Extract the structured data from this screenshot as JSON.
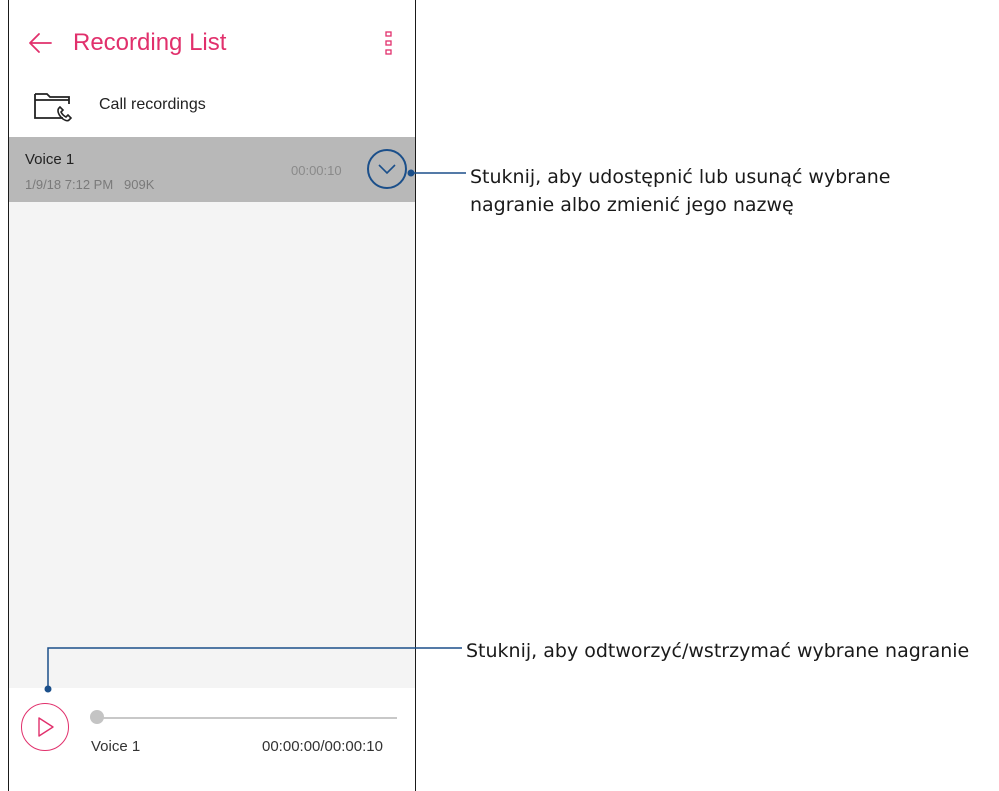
{
  "header": {
    "title": "Recording List",
    "back_icon": "arrow-left-icon",
    "menu_icon": "more-vertical-icon"
  },
  "folder": {
    "label": "Call recordings",
    "icon": "folder-phone-icon"
  },
  "recordings": [
    {
      "name": "Voice 1",
      "meta": "1/9/18 7:12 PM   909K",
      "duration": "00:00:10"
    }
  ],
  "player": {
    "track_name": "Voice 1",
    "time": "00:00:00/00:00:10",
    "progress": 0
  },
  "callouts": {
    "expand": "Stuknij, aby udostępnić lub usunąć wybrane\nnagranie albo zmienić jego nazwę",
    "play": "Stuknij, aby odtworzyć/wstrzymać wybrane nagranie"
  },
  "colors": {
    "accent": "#e1306c",
    "callout_line": "#1b4f8a",
    "selected_row": "#b8b8b8"
  }
}
